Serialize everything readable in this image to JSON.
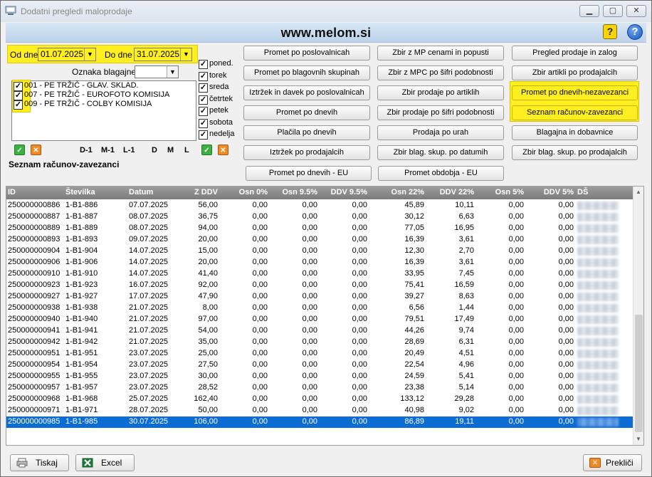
{
  "window": {
    "title": "Dodatni pregledi maloprodaje",
    "icon": "app-icon"
  },
  "banner": {
    "site": "www.melom.si",
    "help_icon": "?",
    "info_icon": "?"
  },
  "filters": {
    "from_label": "Od dne",
    "from_value": "01.07.2025",
    "to_label": "Do dne",
    "to_value": "31.07.2025",
    "register_label": "Oznaka blagajne",
    "register_value": ""
  },
  "locations": [
    {
      "label": "001 - PE TRŽIČ - GLAV. SKLAD.",
      "checked": true
    },
    {
      "label": "007 - PE TRŽIČ - EUROFOTO KOMISIJA",
      "checked": true
    },
    {
      "label": "009 - PE TRŽIČ - COLBY KOMISIJA",
      "checked": true
    }
  ],
  "days": [
    {
      "label": "poned.",
      "checked": true
    },
    {
      "label": "torek",
      "checked": true
    },
    {
      "label": "sreda",
      "checked": true
    },
    {
      "label": "četrtek",
      "checked": true
    },
    {
      "label": "petek",
      "checked": true
    },
    {
      "label": "sobota",
      "checked": true
    },
    {
      "label": "nedelja",
      "checked": true
    }
  ],
  "period_shortcuts": [
    "D-1",
    "M-1",
    "L-1",
    "D",
    "M",
    "L"
  ],
  "section_title": "Seznam računov-zavezanci",
  "buttons": {
    "col1": [
      "Promet po poslovalnicah",
      "Promet po blagovnih skupinah",
      "Iztržek in davek po poslovalnicah",
      "Promet po dnevih",
      "Plačila po dnevih",
      "Iztržek po prodajalcih"
    ],
    "col2": [
      "Zbir z MP cenami in popusti",
      "Zbir z MPC po šifri podobnosti",
      "Zbir prodaje po artiklih",
      "Zbir prodaje po šifri podobnosti",
      "Prodaja po urah",
      "Zbir blag. skup. po datumih"
    ],
    "col3": [
      "Pregled prodaje in zalog",
      "Zbir artikli po prodajalcih",
      "Promet po dnevih-nezavezanci",
      "Seznam računov-zavezanci",
      "Blagajna in dobavnice",
      "Zbir blag. skup. po prodajalcih"
    ],
    "eu": [
      "Promet po dnevih - EU",
      "Promet obdobja - EU"
    ]
  },
  "grid": {
    "columns": [
      "ID",
      "Številka",
      "Datum",
      "Z DDV",
      "Osn 0%",
      "Osn 9.5%",
      "DDV 9.5%",
      "Osn 22%",
      "DDV 22%",
      "Osn 5%",
      "DDV 5%",
      "DŠ"
    ],
    "rows": [
      [
        "250000000886",
        "1-B1-886",
        "07.07.2025",
        "56,00",
        "0,00",
        "0,00",
        "0,00",
        "45,89",
        "10,11",
        "0,00",
        "0,00"
      ],
      [
        "250000000887",
        "1-B1-887",
        "08.07.2025",
        "36,75",
        "0,00",
        "0,00",
        "0,00",
        "30,12",
        "6,63",
        "0,00",
        "0,00"
      ],
      [
        "250000000889",
        "1-B1-889",
        "08.07.2025",
        "94,00",
        "0,00",
        "0,00",
        "0,00",
        "77,05",
        "16,95",
        "0,00",
        "0,00"
      ],
      [
        "250000000893",
        "1-B1-893",
        "09.07.2025",
        "20,00",
        "0,00",
        "0,00",
        "0,00",
        "16,39",
        "3,61",
        "0,00",
        "0,00"
      ],
      [
        "250000000904",
        "1-B1-904",
        "14.07.2025",
        "15,00",
        "0,00",
        "0,00",
        "0,00",
        "12,30",
        "2,70",
        "0,00",
        "0,00"
      ],
      [
        "250000000906",
        "1-B1-906",
        "14.07.2025",
        "20,00",
        "0,00",
        "0,00",
        "0,00",
        "16,39",
        "3,61",
        "0,00",
        "0,00"
      ],
      [
        "250000000910",
        "1-B1-910",
        "14.07.2025",
        "41,40",
        "0,00",
        "0,00",
        "0,00",
        "33,95",
        "7,45",
        "0,00",
        "0,00"
      ],
      [
        "250000000923",
        "1-B1-923",
        "16.07.2025",
        "92,00",
        "0,00",
        "0,00",
        "0,00",
        "75,41",
        "16,59",
        "0,00",
        "0,00"
      ],
      [
        "250000000927",
        "1-B1-927",
        "17.07.2025",
        "47,90",
        "0,00",
        "0,00",
        "0,00",
        "39,27",
        "8,63",
        "0,00",
        "0,00"
      ],
      [
        "250000000938",
        "1-B1-938",
        "21.07.2025",
        "8,00",
        "0,00",
        "0,00",
        "0,00",
        "6,56",
        "1,44",
        "0,00",
        "0,00"
      ],
      [
        "250000000940",
        "1-B1-940",
        "21.07.2025",
        "97,00",
        "0,00",
        "0,00",
        "0,00",
        "79,51",
        "17,49",
        "0,00",
        "0,00"
      ],
      [
        "250000000941",
        "1-B1-941",
        "21.07.2025",
        "54,00",
        "0,00",
        "0,00",
        "0,00",
        "44,26",
        "9,74",
        "0,00",
        "0,00"
      ],
      [
        "250000000942",
        "1-B1-942",
        "21.07.2025",
        "35,00",
        "0,00",
        "0,00",
        "0,00",
        "28,69",
        "6,31",
        "0,00",
        "0,00"
      ],
      [
        "250000000951",
        "1-B1-951",
        "23.07.2025",
        "25,00",
        "0,00",
        "0,00",
        "0,00",
        "20,49",
        "4,51",
        "0,00",
        "0,00"
      ],
      [
        "250000000954",
        "1-B1-954",
        "23.07.2025",
        "27,50",
        "0,00",
        "0,00",
        "0,00",
        "22,54",
        "4,96",
        "0,00",
        "0,00"
      ],
      [
        "250000000955",
        "1-B1-955",
        "23.07.2025",
        "30,00",
        "0,00",
        "0,00",
        "0,00",
        "24,59",
        "5,41",
        "0,00",
        "0,00"
      ],
      [
        "250000000957",
        "1-B1-957",
        "23.07.2025",
        "28,52",
        "0,00",
        "0,00",
        "0,00",
        "23,38",
        "5,14",
        "0,00",
        "0,00"
      ],
      [
        "250000000968",
        "1-B1-968",
        "25.07.2025",
        "162,40",
        "0,00",
        "0,00",
        "0,00",
        "133,12",
        "29,28",
        "0,00",
        "0,00"
      ],
      [
        "250000000971",
        "1-B1-971",
        "28.07.2025",
        "50,00",
        "0,00",
        "0,00",
        "0,00",
        "40,98",
        "9,02",
        "0,00",
        "0,00"
      ],
      [
        "250000000985",
        "1-B1-985",
        "30.07.2025",
        "106,00",
        "0,00",
        "0,00",
        "0,00",
        "86,89",
        "19,11",
        "0,00",
        "0,00"
      ]
    ],
    "selected_row": 19
  },
  "footer": {
    "print_label": "Tiskaj",
    "excel_label": "Excel",
    "cancel_label": "Prekliči"
  },
  "colors": {
    "highlight": "#ffef21",
    "selection": "#0b6cd4",
    "header": "#8c8c8c"
  }
}
